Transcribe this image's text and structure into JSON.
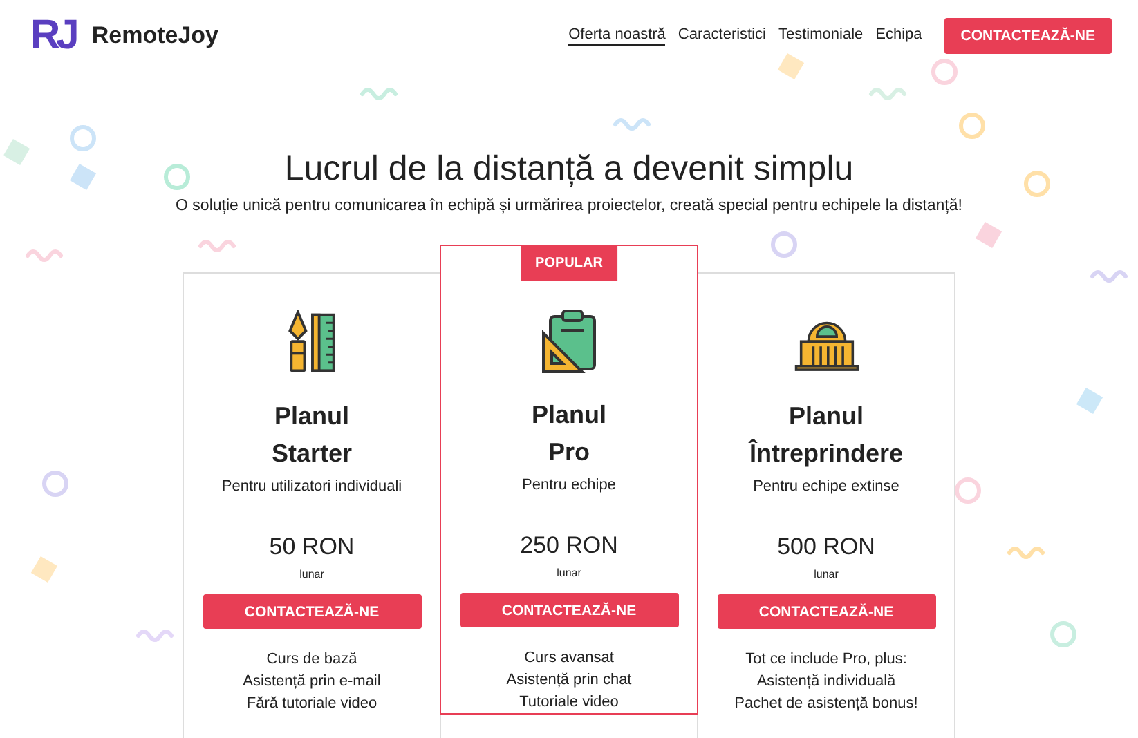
{
  "brand": {
    "logo": "RJ",
    "name": "RemoteJoy"
  },
  "nav": [
    {
      "label": "Oferta noastră",
      "selected": true
    },
    {
      "label": "Caracteristici",
      "selected": false
    },
    {
      "label": "Testimoniale",
      "selected": false
    },
    {
      "label": "Echipa",
      "selected": false
    }
  ],
  "nav_button": "CONTACTEAZĂ-NE",
  "hero": {
    "title": "Lucrul de la distanță a devenit simplu",
    "subtitle": "O soluție unică pentru comunicarea în echipă și urmărirea proiectelor, creată special pentru echipele la distanță!"
  },
  "plans": [
    {
      "title": "Planul Starter",
      "audience": "Pentru utilizatori individuali",
      "price": "50 RON",
      "period": "lunar",
      "button": "CONTACTEAZĂ-NE",
      "featured": false,
      "features": [
        "Curs de bază",
        "Asistență prin e-mail",
        "Fără tutoriale video"
      ]
    },
    {
      "title": "Planul Pro",
      "audience": "Pentru echipe",
      "price": "250 RON",
      "period": "lunar",
      "button": "CONTACTEAZĂ-NE",
      "featured": true,
      "badge": "POPULAR",
      "features": [
        "Curs avansat",
        "Asistență prin chat",
        "Tutoriale video"
      ]
    },
    {
      "title": "Planul Întreprindere",
      "audience": "Pentru echipe extinse",
      "price": "500 RON",
      "period": "lunar",
      "button": "CONTACTEAZĂ-NE",
      "featured": false,
      "features": [
        "Tot ce include Pro, plus:",
        "Asistență individuală",
        "Pachet de asistență bonus!"
      ]
    }
  ]
}
